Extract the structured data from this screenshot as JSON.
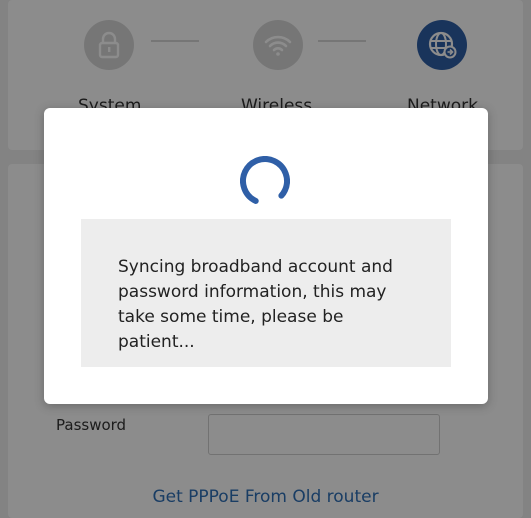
{
  "steps": [
    {
      "label": "System",
      "icon": "lock-icon",
      "state": "inactive"
    },
    {
      "label": "Wireless",
      "icon": "wifi-icon",
      "state": "inactive"
    },
    {
      "label": "Network",
      "icon": "globe-icon",
      "state": "active"
    }
  ],
  "form": {
    "password_label": "Password",
    "password_value": "",
    "pppoe_link": "Get PPPoE From Old router"
  },
  "dialog": {
    "message": "Syncing broadband account and password information, this may take some time, please be patient..."
  },
  "colors": {
    "accent": "#2f5fa7",
    "link": "#2f6fb7",
    "inactive_step": "#d8d8d8",
    "overlay": "rgba(0,0,0,0.45)"
  }
}
